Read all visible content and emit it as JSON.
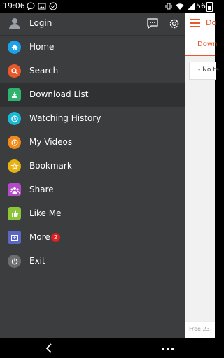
{
  "status_bar": {
    "time": "19:06",
    "battery_level": "56",
    "icons": [
      "chat-bubble-icon",
      "photo-icon",
      "check-circle-icon",
      "vibrate-icon",
      "wifi-icon",
      "signal-icon",
      "battery-icon"
    ]
  },
  "drawer": {
    "header": {
      "login_label": "Login",
      "icons": [
        "avatar-icon",
        "message-icon",
        "settings-icon"
      ]
    },
    "items": [
      {
        "label": "Home",
        "icon": "home-icon",
        "color": "#1aa3e8"
      },
      {
        "label": "Search",
        "icon": "search-icon",
        "color": "#e8582b"
      },
      {
        "label": "Download List",
        "icon": "download-icon",
        "color": "#2fb36d",
        "active": true
      },
      {
        "label": "Watching History",
        "icon": "history-icon",
        "color": "#19b8d6"
      },
      {
        "label": "My Videos",
        "icon": "play-icon",
        "color": "#f08a1c"
      },
      {
        "label": "Bookmark",
        "icon": "star-icon",
        "color": "#e9b214"
      },
      {
        "label": "Share",
        "icon": "share-people-icon",
        "color": "#b34bc9"
      },
      {
        "label": "Like Me",
        "icon": "thumbs-up-icon",
        "color": "#8cc43a"
      },
      {
        "label": "More",
        "icon": "more-box-icon",
        "color": "#5a67c7",
        "badge": "2"
      },
      {
        "label": "Exit",
        "icon": "power-icon",
        "color": "#6b6e71"
      }
    ]
  },
  "app": {
    "title": "Do",
    "tab": "Down",
    "card_text": "- No ta",
    "footer_text": "Free:23.",
    "accent": "#e8582b"
  },
  "nav_bar": {
    "icons": [
      "back-icon",
      "more-dots-icon"
    ]
  }
}
